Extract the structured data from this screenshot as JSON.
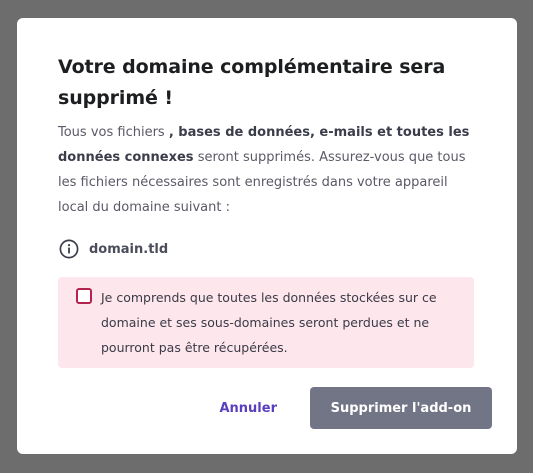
{
  "dialog": {
    "title": "Votre domaine complémentaire sera supprimé !",
    "description": {
      "part1": "Tous vos fichiers ",
      "bold": ", bases de données, e-mails et toutes les données connexes",
      "part2": " seront supprimés. Assurez-vous que tous les fichiers nécessaires sont enregistrés dans votre appareil local du domaine suivant :"
    },
    "domain": "domain.tld",
    "domain_icon": "info-icon",
    "confirmation": {
      "checked": false,
      "label": "Je comprends que toutes les données stockées sur ce domaine et ses sous-domaines seront perdues et ne pourront pas être récupérées."
    },
    "buttons": {
      "cancel": "Annuler",
      "delete": "Supprimer l'add-on"
    }
  },
  "colors": {
    "overlay": "#6d6d6d",
    "modal_bg": "#ffffff",
    "title": "#1d1e20",
    "text": "#5a5a66",
    "warning_bg": "#fde6ec",
    "checkbox_border": "#b3244e",
    "cancel_text": "#5a3fbf",
    "delete_bg": "#727586"
  }
}
